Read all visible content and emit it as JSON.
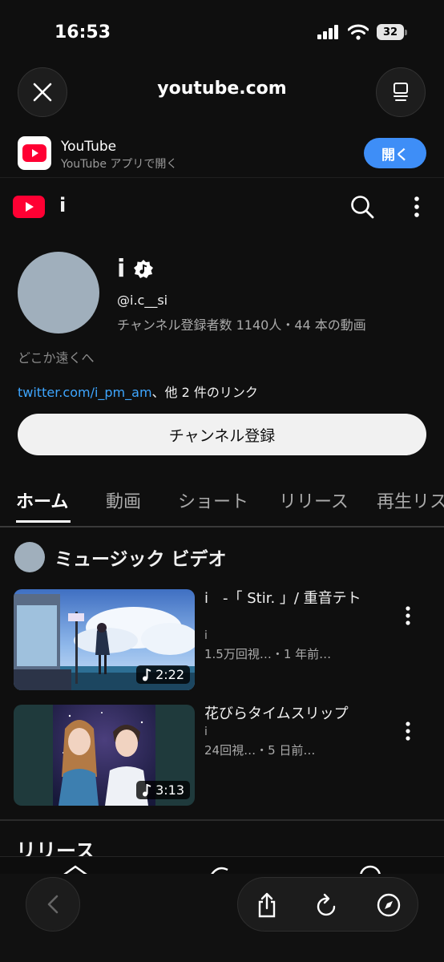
{
  "status_bar": {
    "time": "16:53",
    "battery": "32"
  },
  "browser": {
    "url": "youtube.com",
    "close_icon": "close-icon",
    "tabs_icon": "tabs-icon"
  },
  "app_banner": {
    "app_name": "YouTube",
    "subtitle": "YouTube アプリで開く",
    "open_label": "開く"
  },
  "header": {
    "title": "i",
    "search_icon": "search-icon",
    "more_icon": "more-vertical-icon"
  },
  "channel": {
    "name": "i",
    "handle": "@i.c__si",
    "stats": "チャンネル登録者数 1140人・44 本の動画",
    "description": "どこか遠くへ",
    "link": "twitter.com/i_pm_am",
    "link_suffix": "、他 2 件のリンク",
    "subscribe_label": "チャンネル登録"
  },
  "tabs": [
    {
      "label": "ホーム"
    },
    {
      "label": "動画"
    },
    {
      "label": "ショート"
    },
    {
      "label": "リリース"
    },
    {
      "label": "再生リス"
    }
  ],
  "music_section": {
    "title": "ミュージック ビデオ",
    "videos": [
      {
        "title": "i　-「 Stir. 」/ 重音テト",
        "channel": "i",
        "meta": "1.5万回視…・1 年前…",
        "duration": "2:22"
      },
      {
        "title": "花びらタイムスリップ",
        "channel": "i",
        "meta": "24回視…・5 日前…",
        "duration": "3:13"
      }
    ]
  },
  "release_section": {
    "title": "リリース"
  },
  "toolbar": {
    "back_icon": "back-icon",
    "share_icon": "share-icon",
    "reload_icon": "reload-icon",
    "compass_icon": "compass-icon"
  }
}
